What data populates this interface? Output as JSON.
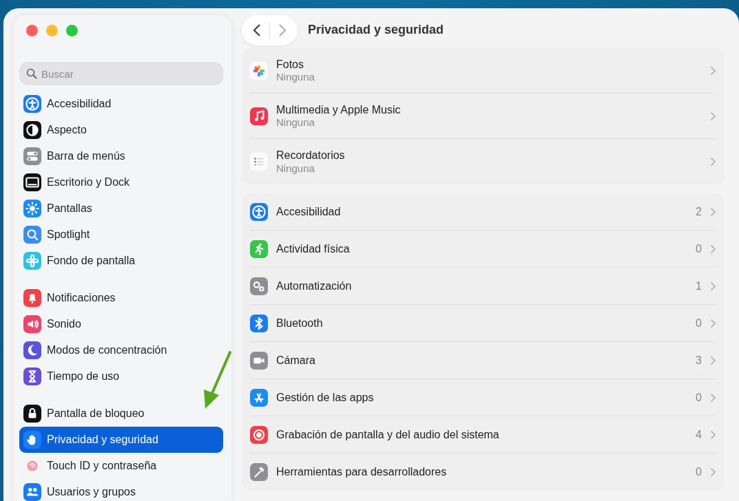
{
  "window": {
    "title": "Privacidad y seguridad"
  },
  "search": {
    "placeholder": "Buscar"
  },
  "sidebar": {
    "groups": [
      {
        "items": [
          {
            "label": "Accesibilidad",
            "kind": "accessibility",
            "selected": false
          },
          {
            "label": "Aspecto",
            "kind": "appearance",
            "selected": false
          },
          {
            "label": "Barra de menús",
            "kind": "menubar",
            "selected": false
          },
          {
            "label": "Escritorio y Dock",
            "kind": "dock",
            "selected": false
          },
          {
            "label": "Pantallas",
            "kind": "displays",
            "selected": false
          },
          {
            "label": "Spotlight",
            "kind": "spotlight",
            "selected": false
          },
          {
            "label": "Fondo de pantalla",
            "kind": "wallpaper",
            "selected": false
          }
        ]
      },
      {
        "items": [
          {
            "label": "Notificaciones",
            "kind": "notifications",
            "selected": false
          },
          {
            "label": "Sonido",
            "kind": "sound",
            "selected": false
          },
          {
            "label": "Modos de concentración",
            "kind": "focus",
            "selected": false
          },
          {
            "label": "Tiempo de uso",
            "kind": "screentime",
            "selected": false
          }
        ]
      },
      {
        "items": [
          {
            "label": "Pantalla de bloqueo",
            "kind": "lock",
            "selected": false
          },
          {
            "label": "Privacidad y seguridad",
            "kind": "privacy",
            "selected": true
          },
          {
            "label": "Touch ID y contraseña",
            "kind": "touchid",
            "selected": false
          },
          {
            "label": "Usuarios y grupos",
            "kind": "users",
            "selected": false
          }
        ]
      }
    ]
  },
  "sections": [
    {
      "rows": [
        {
          "title": "Fotos",
          "subtitle": "Ninguna",
          "kind": "photos"
        },
        {
          "title": "Multimedia y Apple Music",
          "subtitle": "Ninguna",
          "kind": "music"
        },
        {
          "title": "Recordatorios",
          "subtitle": "Ninguna",
          "kind": "reminders"
        }
      ]
    },
    {
      "rows": [
        {
          "title": "Accesibilidad",
          "count": "2",
          "kind": "accessibility"
        },
        {
          "title": "Actividad física",
          "count": "0",
          "kind": "fitness"
        },
        {
          "title": "Automatización",
          "count": "1",
          "kind": "automation"
        },
        {
          "title": "Bluetooth",
          "count": "0",
          "kind": "bluetooth"
        },
        {
          "title": "Cámara",
          "count": "3",
          "kind": "camera"
        },
        {
          "title": "Gestión de las apps",
          "count": "0",
          "kind": "apps"
        },
        {
          "title": "Grabación de pantalla y del audio del sistema",
          "count": "4",
          "kind": "recording"
        },
        {
          "title": "Herramientas para desarrolladores",
          "count": "0",
          "kind": "devtools"
        }
      ]
    }
  ]
}
